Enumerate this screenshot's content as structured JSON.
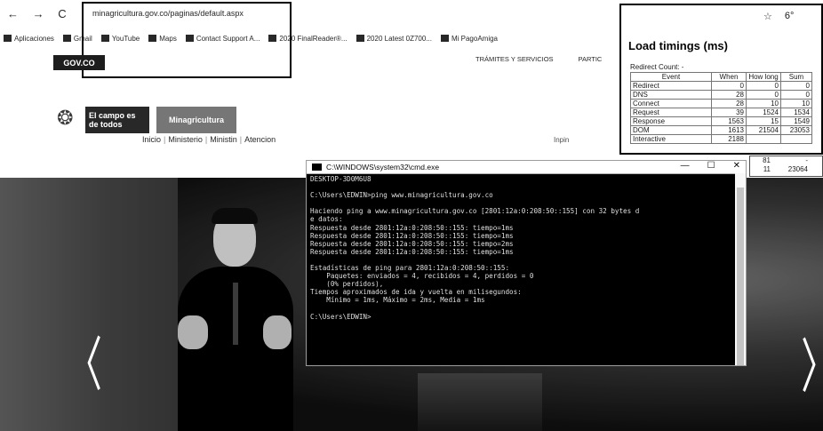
{
  "browser": {
    "nav_glyphs": "← → C",
    "url": "minagricultura.gov.co/paginas/default.aspx",
    "bookmarks": [
      {
        "label": "Aplicaciones"
      },
      {
        "label": "Gmail"
      },
      {
        "label": "YouTube"
      },
      {
        "label": "Maps"
      },
      {
        "label": "Contact Support A..."
      },
      {
        "label": "2020 FinalReader®..."
      },
      {
        "label": "2020 Latest 0Z700..."
      },
      {
        "label": "Mi PagoAmiga"
      }
    ]
  },
  "site": {
    "govco": "GOV.CO",
    "topnav": [
      "TRÁMITES Y SERVICIOS",
      "PARTIC"
    ],
    "logo_campo": "El campo es de todos",
    "logo_min": "Minagricultura",
    "menu": [
      "Inicio",
      "Ministerio",
      "Ministin",
      "Atencion"
    ],
    "search_label": "Inpin"
  },
  "load_timings": {
    "top_icons": [
      "☆",
      "6°"
    ],
    "title": "Load timings (ms)",
    "redirect_count": "Redirect Count: -",
    "headers": [
      "Event",
      "When",
      "How long",
      "Sum"
    ],
    "rows": [
      {
        "event": "Redirect",
        "when": "0",
        "how_long": "0",
        "sum": "0"
      },
      {
        "event": "DNS",
        "when": "28",
        "how_long": "0",
        "sum": "0"
      },
      {
        "event": "Connect",
        "when": "28",
        "how_long": "10",
        "sum": "10"
      },
      {
        "event": "Request",
        "when": "39",
        "how_long": "1524",
        "sum": "1534"
      },
      {
        "event": "Response",
        "when": "1563",
        "how_long": "15",
        "sum": "1549"
      },
      {
        "event": "DOM",
        "when": "1613",
        "how_long": "21504",
        "sum": "23053"
      },
      {
        "event": "Interactive",
        "when": "2188",
        "how_long": "",
        "sum": ""
      }
    ],
    "extra_rows": [
      {
        "a": "81",
        "b": "-"
      },
      {
        "a": "11",
        "b": "23064"
      }
    ]
  },
  "cmd": {
    "title": "C:\\WINDOWS\\system32\\cmd.exe",
    "controls": [
      "—",
      "☐",
      "✕"
    ],
    "lines": [
      "DESKTOP-3D0M6U8",
      "",
      "C:\\Users\\EDWIN>ping www.minagricultura.gov.co",
      "",
      "Haciendo ping a www.minagricultura.gov.co [2801:12a:0:208:50::155] con 32 bytes d",
      "e datos:",
      "Respuesta desde 2801:12a:0:208:50::155: tiempo=1ms",
      "Respuesta desde 2801:12a:0:208:50::155: tiempo=1ms",
      "Respuesta desde 2801:12a:0:208:50::155: tiempo=2ms",
      "Respuesta desde 2801:12a:0:208:50::155: tiempo=1ms",
      "",
      "Estadísticas de ping para 2801:12a:0:208:50::155:",
      "    Paquetes: enviados = 4, recibidos = 4, perdidos = 0",
      "    (0% perdidos),",
      "Tiempos aproximados de ida y vuelta en milisegundos:",
      "    Mínimo = 1ms, Máximo = 2ms, Media = 1ms",
      "",
      "C:\\Users\\EDWIN>"
    ]
  },
  "hero": {
    "prev_arrow": "〈",
    "next_arrow": "〉"
  }
}
